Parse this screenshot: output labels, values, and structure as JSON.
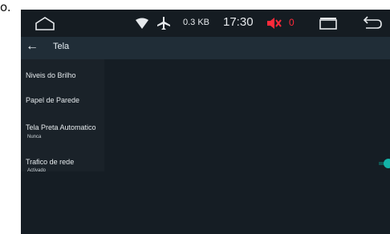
{
  "page_letter": "o.",
  "status": {
    "net_speed": "0.3 KB",
    "time": "17:30",
    "count": "0",
    "colors": {
      "mute_icon": "#ff2a3a",
      "count": "#ff2a3a"
    }
  },
  "title_bar": {
    "title": "Tela"
  },
  "menu": {
    "items": [
      {
        "label": "Niveis do Brilho"
      },
      {
        "label": "Papel de Parede"
      },
      {
        "label": "Tela Preta Automatico",
        "sub": "Nunca"
      },
      {
        "label": "Trafico de rede",
        "sub": "Activado"
      }
    ]
  },
  "toggle": {
    "state": "on",
    "color": "#13b3a8"
  }
}
